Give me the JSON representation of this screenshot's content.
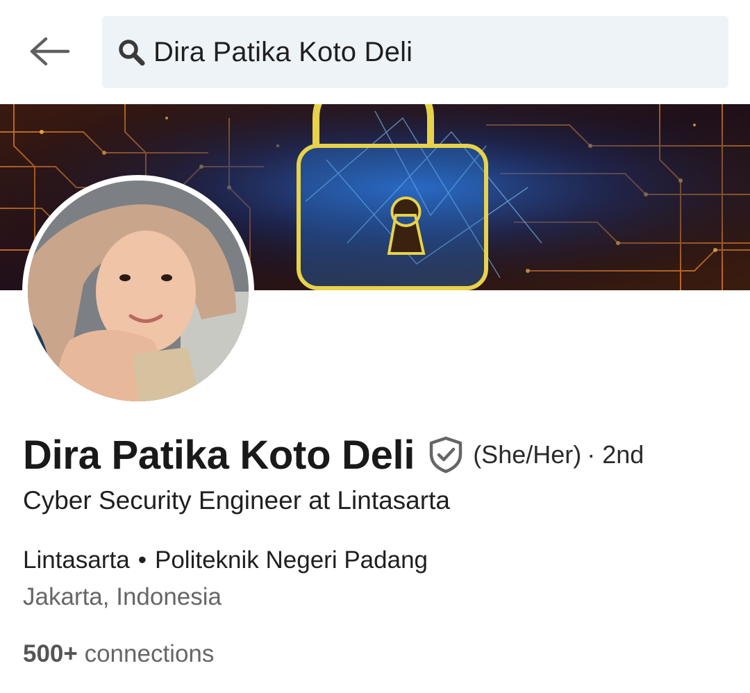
{
  "header": {
    "search_value": "Dira Patika Koto Deli",
    "icons": {
      "back": "arrow-left-icon",
      "search": "search-icon"
    }
  },
  "banner": {
    "image": "cyber-security-padlock-circuit-banner"
  },
  "profile": {
    "avatar": "profile-photo",
    "name": "Dira Patika Koto Deli",
    "verified_icon": "shield-check-icon",
    "pronouns": "(She/Her)",
    "degree": "· 2nd",
    "headline": "Cyber Security Engineer at Lintasarta",
    "company": "Lintasarta",
    "separator": "•",
    "school": "Politeknik Negeri Padang",
    "location": "Jakarta, Indonesia",
    "connections_count": "500+",
    "connections_label": "connections"
  },
  "colors": {
    "search_bg": "#eef3f8",
    "text_primary": "#191919",
    "text_secondary": "#666666",
    "icon_gray": "#666666"
  }
}
